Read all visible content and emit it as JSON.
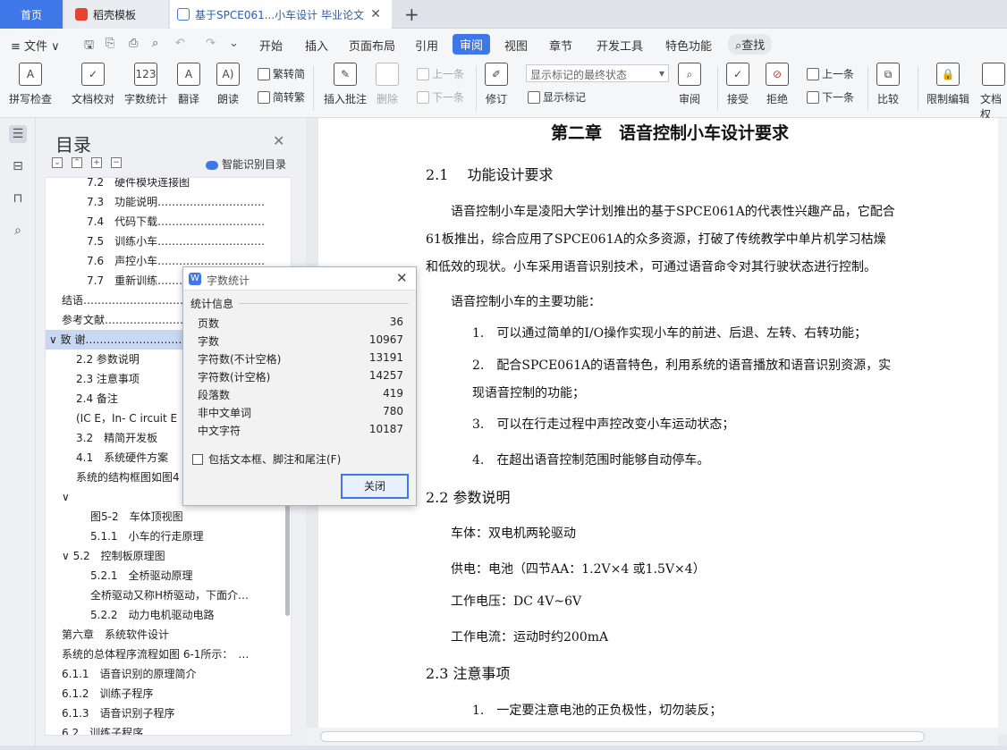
{
  "tabs": {
    "home": "首页",
    "template": "稻壳模板",
    "document": "基于SPCE061...小车设计 毕业论文"
  },
  "menu": {
    "file": "文件",
    "items": [
      "开始",
      "插入",
      "页面布局",
      "引用",
      "审阅",
      "视图",
      "章节",
      "开发工具",
      "特色功能"
    ],
    "active": "审阅",
    "search": "查找"
  },
  "ribbon": {
    "spell": "拼写检查",
    "proof": "文档校对",
    "wordcount": "字数统计",
    "translate": "翻译",
    "read": "朗读",
    "trad": "繁转简",
    "simp": "简转繁",
    "insert_comment": "插入批注",
    "delete": "删除",
    "prev_comment": "上一条",
    "next_comment": "下一条",
    "track": "修订",
    "markup_select": "显示标记的最终状态",
    "show_markup": "显示标记",
    "review": "审阅",
    "accept": "接受",
    "reject": "拒绝",
    "prev": "上一条",
    "next": "下一条",
    "compare": "比较",
    "restrict": "限制编辑",
    "doc_rights": "文档权"
  },
  "toc": {
    "title": "目录",
    "smart": "智能识别目录",
    "items": [
      {
        "text": "7.2　硬件模块连接图",
        "indent": 46
      },
      {
        "text": "7.3　功能说明…………………………",
        "indent": 46
      },
      {
        "text": "7.4　代码下载…………………………",
        "indent": 46
      },
      {
        "text": "7.5　训练小车…………………………",
        "indent": 46
      },
      {
        "text": "7.6　声控小车…………………………",
        "indent": 46
      },
      {
        "text": "7.7　重新训练…………………………",
        "indent": 46
      },
      {
        "text": "结语…………………………………",
        "indent": 18
      },
      {
        "text": "参考文献…………………………",
        "indent": 18
      },
      {
        "text": "∨  致  谢…………………………",
        "indent": 4,
        "sel": true
      },
      {
        "text": "2.2  参数说明",
        "indent": 34
      },
      {
        "text": "2.3  注意事项",
        "indent": 34
      },
      {
        "text": "2.4  备注",
        "indent": 34
      },
      {
        "text": "(IC E，In- C ircuit E",
        "indent": 34
      },
      {
        "text": "3.2　精简开发板",
        "indent": 34
      },
      {
        "text": "4.1　系统硬件方案",
        "indent": 34
      },
      {
        "text": "系统的结构框图如图4",
        "indent": 34
      },
      {
        "text": "∨",
        "indent": 18
      },
      {
        "text": "图5-2　车体顶视图",
        "indent": 50
      },
      {
        "text": "5.1.1　小车的行走原理",
        "indent": 50
      },
      {
        "text": "∨  5.2　控制板原理图",
        "indent": 18
      },
      {
        "text": "5.2.1　全桥驱动原理",
        "indent": 50
      },
      {
        "text": "全桥驱动又称H桥驱动，下面介…",
        "indent": 50
      },
      {
        "text": "5.2.2　动力电机驱动电路",
        "indent": 50
      },
      {
        "text": "第六章　系统软件设计",
        "indent": 18
      },
      {
        "text": "系统的总体程序流程如图 6-1所示：　…",
        "indent": 18
      },
      {
        "text": "6.1.1　语音识别的原理简介",
        "indent": 18
      },
      {
        "text": "6.1.2　训练子程序",
        "indent": 18
      },
      {
        "text": "6.1.3　语音识别子程序",
        "indent": 18
      },
      {
        "text": "6.2　训练子程序",
        "indent": 18
      }
    ]
  },
  "dialog": {
    "title": "字数统计",
    "section": "统计信息",
    "rows": [
      {
        "label": "页数",
        "value": "36"
      },
      {
        "label": "字数",
        "value": "10967"
      },
      {
        "label": "字符数(不计空格)",
        "value": "13191"
      },
      {
        "label": "字符数(计空格)",
        "value": "14257"
      },
      {
        "label": "段落数",
        "value": "419"
      },
      {
        "label": "非中文单词",
        "value": "780"
      },
      {
        "label": "中文字符",
        "value": "10187"
      }
    ],
    "checkbox": "包括文本框、脚注和尾注(F)",
    "close": "关闭"
  },
  "doc": {
    "chapter": "第二章　语音控制小车设计要求",
    "s21": "2.1　 功能设计要求",
    "p1a": "语音控制小车是凌阳大学计划推出的基于SPCE061A的代表性兴趣产品，它配合",
    "p1b": "61板推出，综合应用了SPCE061A的众多资源，打破了传统教学中单片机学习枯燥",
    "p1c": "和低效的现状。小车采用语音识别技术，可通过语音命令对其行驶状态进行控制。",
    "p2": "语音控制小车的主要功能：",
    "l1": "1.　可以通过简单的I/O操作实现小车的前进、后退、左转、右转功能；",
    "l2a": "2.　配合SPCE061A的语音特色，利用系统的语音播放和语音识别资源，实",
    "l2b": "现语音控制的功能；",
    "l3": "3.　可以在行走过程中声控改变小车运动状态；",
    "l4": "4.　在超出语音控制范围时能够自动停车。",
    "s22": "2.2  参数说明",
    "b1": "车体：双电机两轮驱动",
    "b2": "供电：电池（四节AA：1.2V×4  或1.5V×4）",
    "b3": "工作电压：DC 4V~6V",
    "b4": "工作电流：运动时约200mA",
    "s23": "2.3  注意事项",
    "n1": "1.　一定要注意电池的正负极性，切勿装反；"
  }
}
